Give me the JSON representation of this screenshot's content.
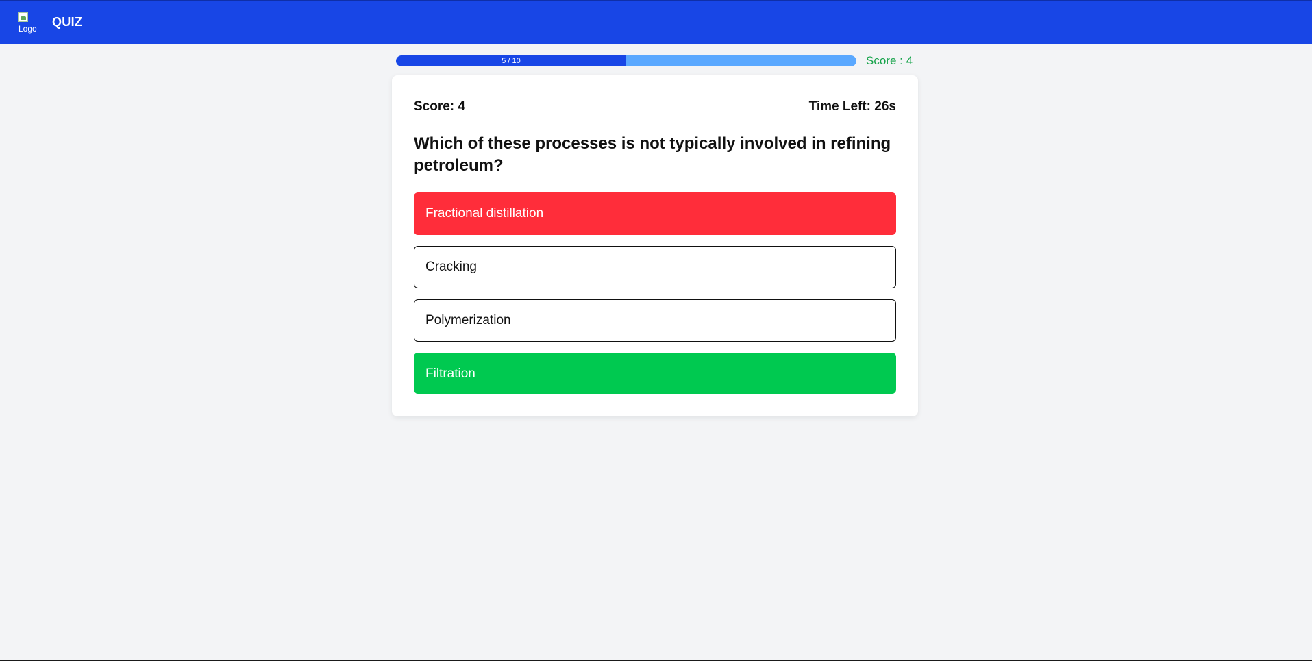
{
  "header": {
    "logo_alt": "Logo",
    "brand": "QUIZ",
    "bar_color": "#1846e6"
  },
  "progress": {
    "current": 5,
    "total": 10,
    "label": "5 / 10",
    "fraction": 0.5,
    "score_label": "Score : 4",
    "fill_color": "#1846e6",
    "track_color": "#5aa8ff"
  },
  "card": {
    "score_label": "Score: 4",
    "time_label": "Time Left: 26s",
    "question": "Which of these processes is not typically involved in refining petroleum?",
    "options": [
      {
        "label": "Fractional distillation",
        "state": "wrong"
      },
      {
        "label": "Cracking",
        "state": "neutral"
      },
      {
        "label": "Polymerization",
        "state": "neutral"
      },
      {
        "label": "Filtration",
        "state": "correct"
      }
    ]
  },
  "colors": {
    "wrong": "#ff2d3a",
    "correct": "#00c950",
    "score_green": "#16a34a"
  }
}
